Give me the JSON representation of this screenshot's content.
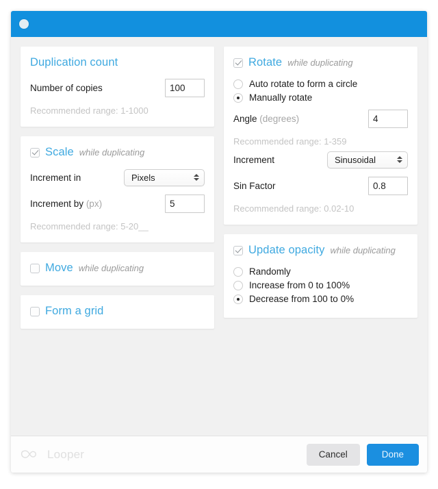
{
  "titlebar": {
    "dot": "window-dot"
  },
  "left": {
    "duplication": {
      "title": "Duplication count",
      "copies_label": "Number of copies",
      "copies_value": "100",
      "hint": "Recommended range: 1-1000"
    },
    "scale": {
      "title": "Scale",
      "subtitle": "while duplicating",
      "checked": true,
      "increment_in_label": "Increment in",
      "increment_in_value": "Pixels",
      "increment_by_label": "Increment by",
      "increment_by_unit": "(px)",
      "increment_by_value": "5",
      "hint": "Recommended range: 5-20__"
    },
    "move": {
      "title": "Move",
      "subtitle": "while duplicating",
      "checked": false
    },
    "grid": {
      "title": "Form a grid",
      "checked": false
    }
  },
  "right": {
    "rotate": {
      "title": "Rotate",
      "subtitle": "while duplicating",
      "checked": true,
      "options": [
        {
          "label": "Auto rotate to form a circle",
          "selected": false
        },
        {
          "label": "Manually rotate",
          "selected": true
        }
      ],
      "angle_label": "Angle",
      "angle_unit": "(degrees)",
      "angle_value": "4",
      "angle_hint": "Recommended range: 1-359",
      "increment_label": "Increment",
      "increment_value": "Sinusoidal",
      "sin_label": "Sin Factor",
      "sin_value": "0.8",
      "sin_hint": "Recommended range: 0.02-10"
    },
    "opacity": {
      "title": "Update opacity",
      "subtitle": "while duplicating",
      "checked": true,
      "options": [
        {
          "label": "Randomly",
          "selected": false
        },
        {
          "label": "Increase from 0 to 100%",
          "selected": false
        },
        {
          "label": "Decrease from 100 to 0%",
          "selected": true
        }
      ]
    }
  },
  "footer": {
    "brand": "Looper",
    "cancel_label": "Cancel",
    "done_label": "Done"
  },
  "colors": {
    "titlebar": "#1290de",
    "accent": "#3fa9e0",
    "done": "#1b8fe0",
    "cancel": "#e4e4e6",
    "hint": "#c4c4c4",
    "background": "#f1f1f1"
  }
}
